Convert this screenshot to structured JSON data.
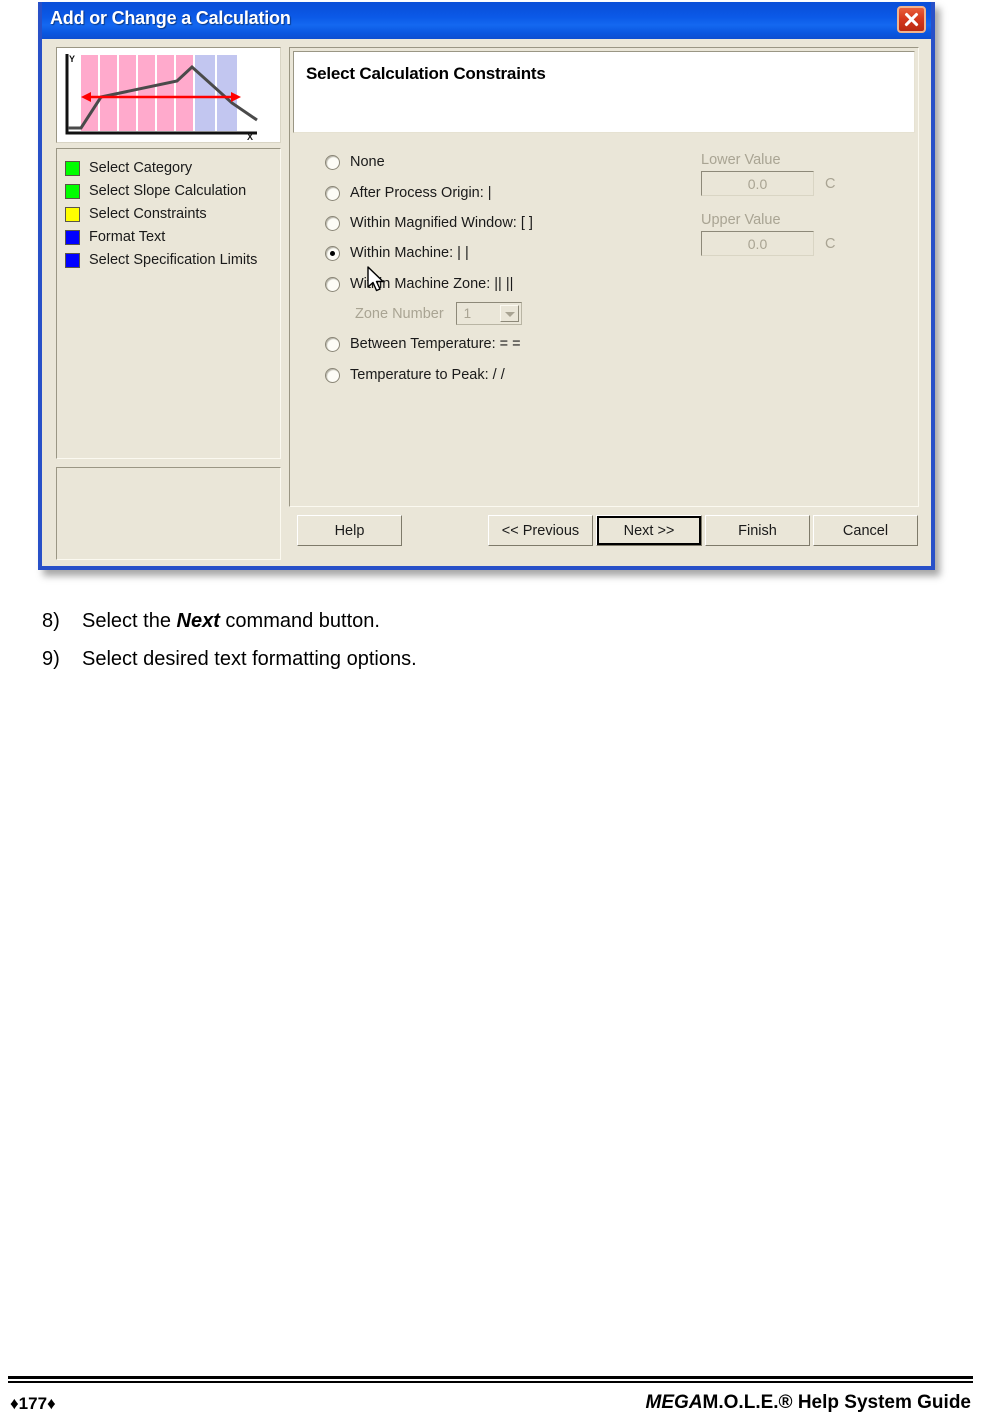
{
  "dialog": {
    "title": "Add or Change a Calculation",
    "close_icon": "close-icon",
    "header_title": "Select Calculation Constraints",
    "sidebar": {
      "thumbnail": {
        "y_axis_label": "Y",
        "x_axis_label": "X",
        "band_color_primary": "#FFAACC",
        "band_color_secondary": "#C2C6F0",
        "curve_color": "#4A4A4A",
        "arrow_color": "#FF0000"
      },
      "steps": [
        {
          "label": "Select Category",
          "color": "#00FF00"
        },
        {
          "label": "Select Slope Calculation",
          "color": "#00FF00"
        },
        {
          "label": "Select Constraints",
          "color": "#FFFF00"
        },
        {
          "label": "Format Text",
          "color": "#0000FF"
        },
        {
          "label": "Select Specification Limits",
          "color": "#0000FF"
        }
      ]
    },
    "constraints": {
      "options": [
        {
          "label": "None",
          "selected": false
        },
        {
          "label": "After Process Origin: |",
          "selected": false
        },
        {
          "label": "Within Magnified Window: [  ]",
          "selected": false
        },
        {
          "label": "Within Machine: |  |",
          "selected": true
        },
        {
          "label": "Within Machine Zone: ||  ||",
          "selected": false
        },
        {
          "label": "Between Temperature: =  =",
          "selected": false
        },
        {
          "label": "Temperature to Peak: /  /",
          "selected": false
        }
      ],
      "zone_number": {
        "label": "Zone Number",
        "value": "1"
      },
      "lower_value": {
        "label": "Lower Value",
        "value": "0.0",
        "unit": "C"
      },
      "upper_value": {
        "label": "Upper Value",
        "value": "0.0",
        "unit": "C"
      }
    },
    "buttons": {
      "help": "Help",
      "previous": "<< Previous",
      "next": "Next >>",
      "finish": "Finish",
      "cancel": "Cancel"
    }
  },
  "page": {
    "instructions": [
      {
        "num": "8)",
        "pre": "Select the ",
        "em": "Next",
        "post": " command button."
      },
      {
        "num": "9)",
        "pre": "Select desired text formatting options.",
        "em": "",
        "post": ""
      }
    ],
    "footer": {
      "page_number": "♦177♦",
      "guide_brand": "MEGA",
      "guide_rest": "M.O.L.E.® Help System Guide"
    }
  }
}
